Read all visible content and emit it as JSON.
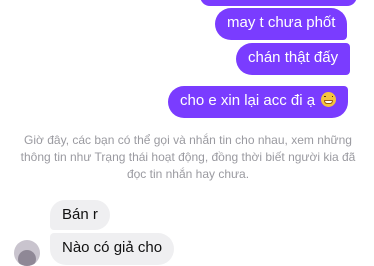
{
  "messages": {
    "sent": [
      {
        "text": ""
      },
      {
        "text": "may t chưa phốt"
      },
      {
        "text": "chán thật đấy"
      },
      {
        "text": "cho e xin lại acc đi ạ",
        "emoji": "grinning-face-emoji"
      }
    ],
    "received": [
      {
        "text": "Bán r"
      },
      {
        "text": "Nào có giả cho"
      }
    ]
  },
  "notice": {
    "text": "Giờ đây, các bạn có thể gọi và nhắn tin cho nhau, xem những thông tin như Trạng thái hoạt động, đồng thời biết người kia đã đọc tin nhắn hay chưa."
  },
  "colors": {
    "sent_bubble": "#7a3cff",
    "received_bubble": "#efeff1",
    "notice_text": "#9a9aa0"
  }
}
